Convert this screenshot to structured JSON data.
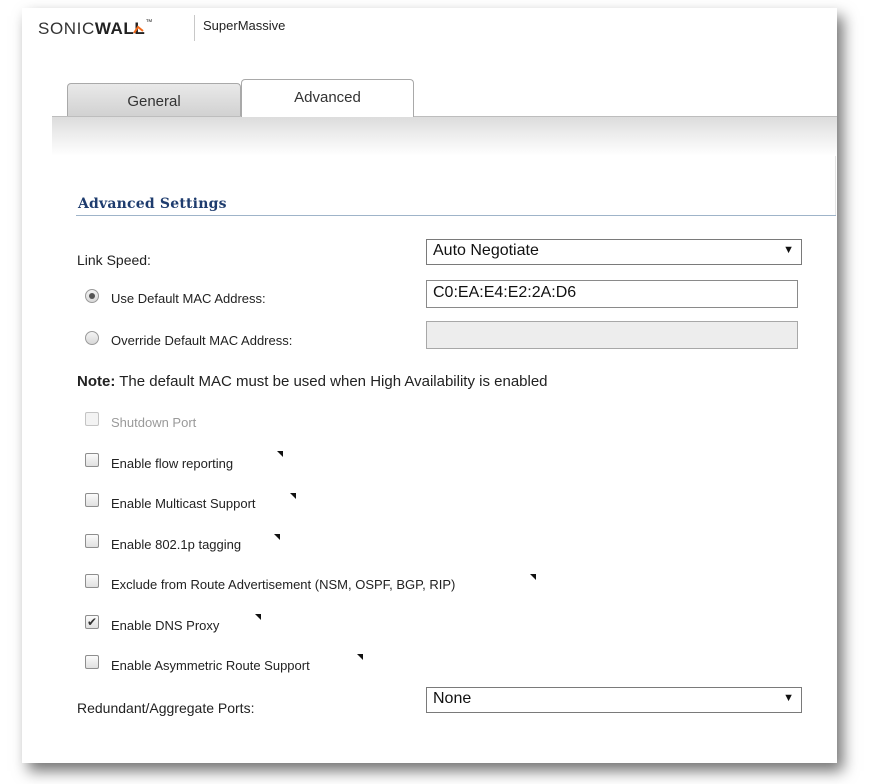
{
  "header": {
    "brand_prefix": "SONIC",
    "brand_suffix": "WALL",
    "product": "SuperMassive"
  },
  "tabs": [
    {
      "label": "General",
      "selected": false
    },
    {
      "label": "Advanced",
      "selected": true
    }
  ],
  "section": {
    "title": "Advanced Settings"
  },
  "link_speed": {
    "label": "Link Speed:",
    "value": "Auto Negotiate"
  },
  "mac": {
    "use_default_label": "Use Default MAC Address:",
    "use_default_selected": true,
    "default_value": "C0:EA:E4:E2:2A:D6",
    "override_label": "Override Default MAC Address:",
    "override_value": ""
  },
  "note": {
    "bold": "Note:",
    "text": " The default MAC must be used when High Availability is enabled"
  },
  "options": [
    {
      "label": "Shutdown Port",
      "checked": false,
      "disabled": true
    },
    {
      "label": "Enable flow reporting",
      "checked": false,
      "disabled": false
    },
    {
      "label": "Enable Multicast Support",
      "checked": false,
      "disabled": false
    },
    {
      "label": "Enable 802.1p tagging",
      "checked": false,
      "disabled": false
    },
    {
      "label": "Exclude from Route Advertisement (NSM, OSPF, BGP, RIP)",
      "checked": false,
      "disabled": false
    },
    {
      "label": "Enable DNS Proxy",
      "checked": true,
      "disabled": false
    },
    {
      "label": "Enable Asymmetric Route Support",
      "checked": false,
      "disabled": false
    }
  ],
  "redundant": {
    "label": "Redundant/Aggregate Ports:",
    "value": "None"
  },
  "icons": {
    "dropdown": "triangle-down",
    "checkmark": "check-mark",
    "tooltip": "corner-triangle-tooltip"
  }
}
